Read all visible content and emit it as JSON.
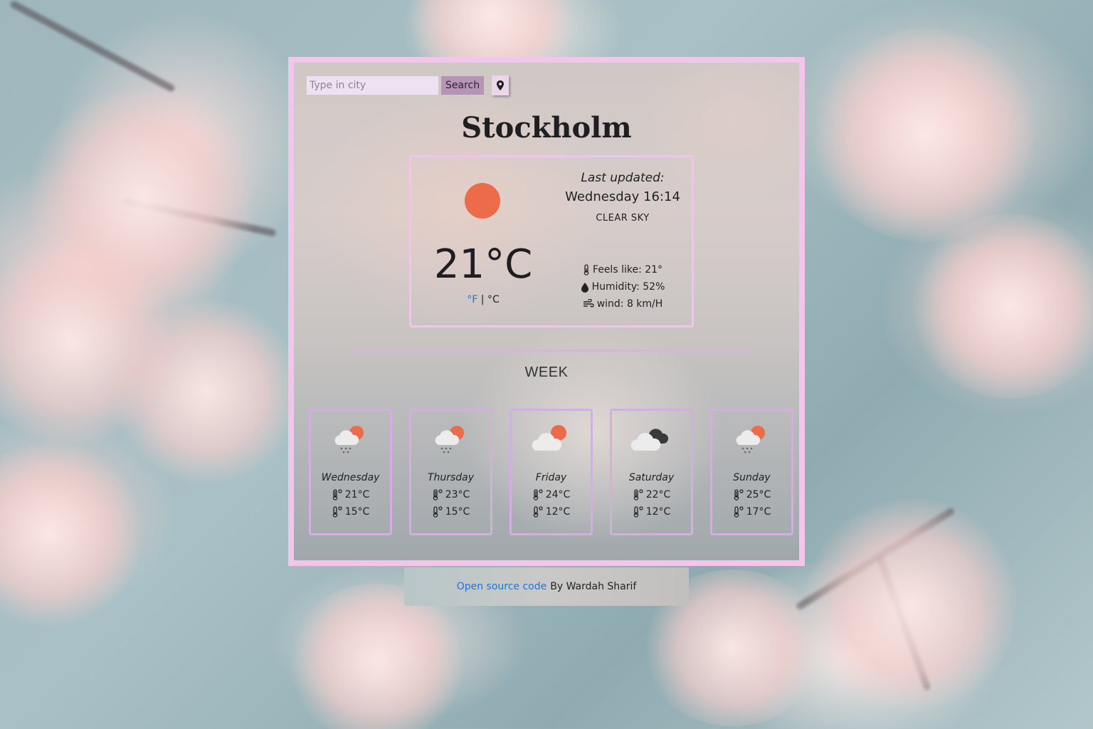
{
  "search": {
    "placeholder": "Type in city",
    "value": "",
    "button_label": "Search"
  },
  "location_button": {
    "icon": "location-pin-icon"
  },
  "city": "Stockholm",
  "current": {
    "icon": "sun-icon",
    "temperature": "21°C",
    "unit_f": "°F",
    "unit_separator": "|",
    "unit_c": "°C",
    "last_updated_label": "Last updated:",
    "last_updated_time": "Wednesday 16:14",
    "condition": "CLEAR SKY",
    "feels_like": "Feels like: 21°",
    "humidity": "Humidity: 52%",
    "wind": "wind: 8 km/H"
  },
  "week_title": "WEEK",
  "forecast": [
    {
      "day": "Wednesday",
      "icon": "sun-cloud-rain-icon",
      "max": "21°C",
      "min": "15°C"
    },
    {
      "day": "Thursday",
      "icon": "sun-cloud-rain-icon",
      "max": "23°C",
      "min": "15°C"
    },
    {
      "day": "Friday",
      "icon": "sun-cloud-icon",
      "max": "24°C",
      "min": "12°C"
    },
    {
      "day": "Saturday",
      "icon": "dark-cloud-icon",
      "max": "22°C",
      "min": "12°C"
    },
    {
      "day": "Sunday",
      "icon": "sun-cloud-rain-icon",
      "max": "25°C",
      "min": "17°C"
    }
  ],
  "footer": {
    "link_label": "Open source code",
    "author": "By Wardah Sharif"
  },
  "colors": {
    "card_border": "#f0c6ea",
    "sun": "#ec6b4a",
    "link": "#1a73e8",
    "search_button": "#b594b6",
    "day_card_border": "#d4aee0"
  }
}
